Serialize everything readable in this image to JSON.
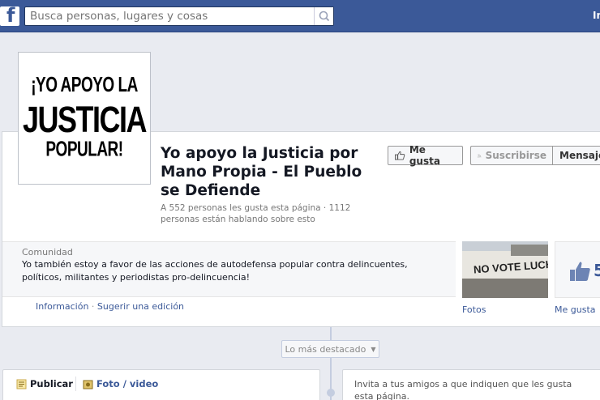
{
  "topbar": {
    "logo": "f",
    "search_placeholder": "Busca personas, lugares y cosas",
    "right_text": "In"
  },
  "profile_picture": {
    "line1": "¡YO APOYO LA",
    "line2": "JUSTICIA",
    "line3": "POPULAR!"
  },
  "page": {
    "title": "Yo apoyo la Justicia por Mano Propia - El Pueblo se Defiende",
    "stats": "A 552 personas les gusta esta página · 1112 personas están hablando sobre esto"
  },
  "actions": {
    "like_label": "Me gusta",
    "subscribe_label": "Suscribirse",
    "message_label": "Mensaje"
  },
  "about": {
    "category": "Comunidad",
    "description": "Yo también estoy a favor de las acciones de autodefensa popular contra delincuentes, políticos, militantes y periodistas pro-delincuencia!",
    "info_link": "Información",
    "separator": "·",
    "suggest_link": "Sugerir una edición"
  },
  "apps": {
    "photos_label": "Fotos",
    "photo_graffiti": "NO VOTE LUCHE",
    "likes_label": "Me gusta",
    "likes_count": "5"
  },
  "timeline": {
    "highlights_label": "Lo más destacado"
  },
  "composer": {
    "post_label": "Publicar",
    "photo_label": "Foto / video"
  },
  "invite": {
    "text": "Invita a tus amigos a que indiquen que les gusta esta página."
  },
  "colors": {
    "brand_blue": "#3b5998",
    "background": "#e9ebf1"
  }
}
